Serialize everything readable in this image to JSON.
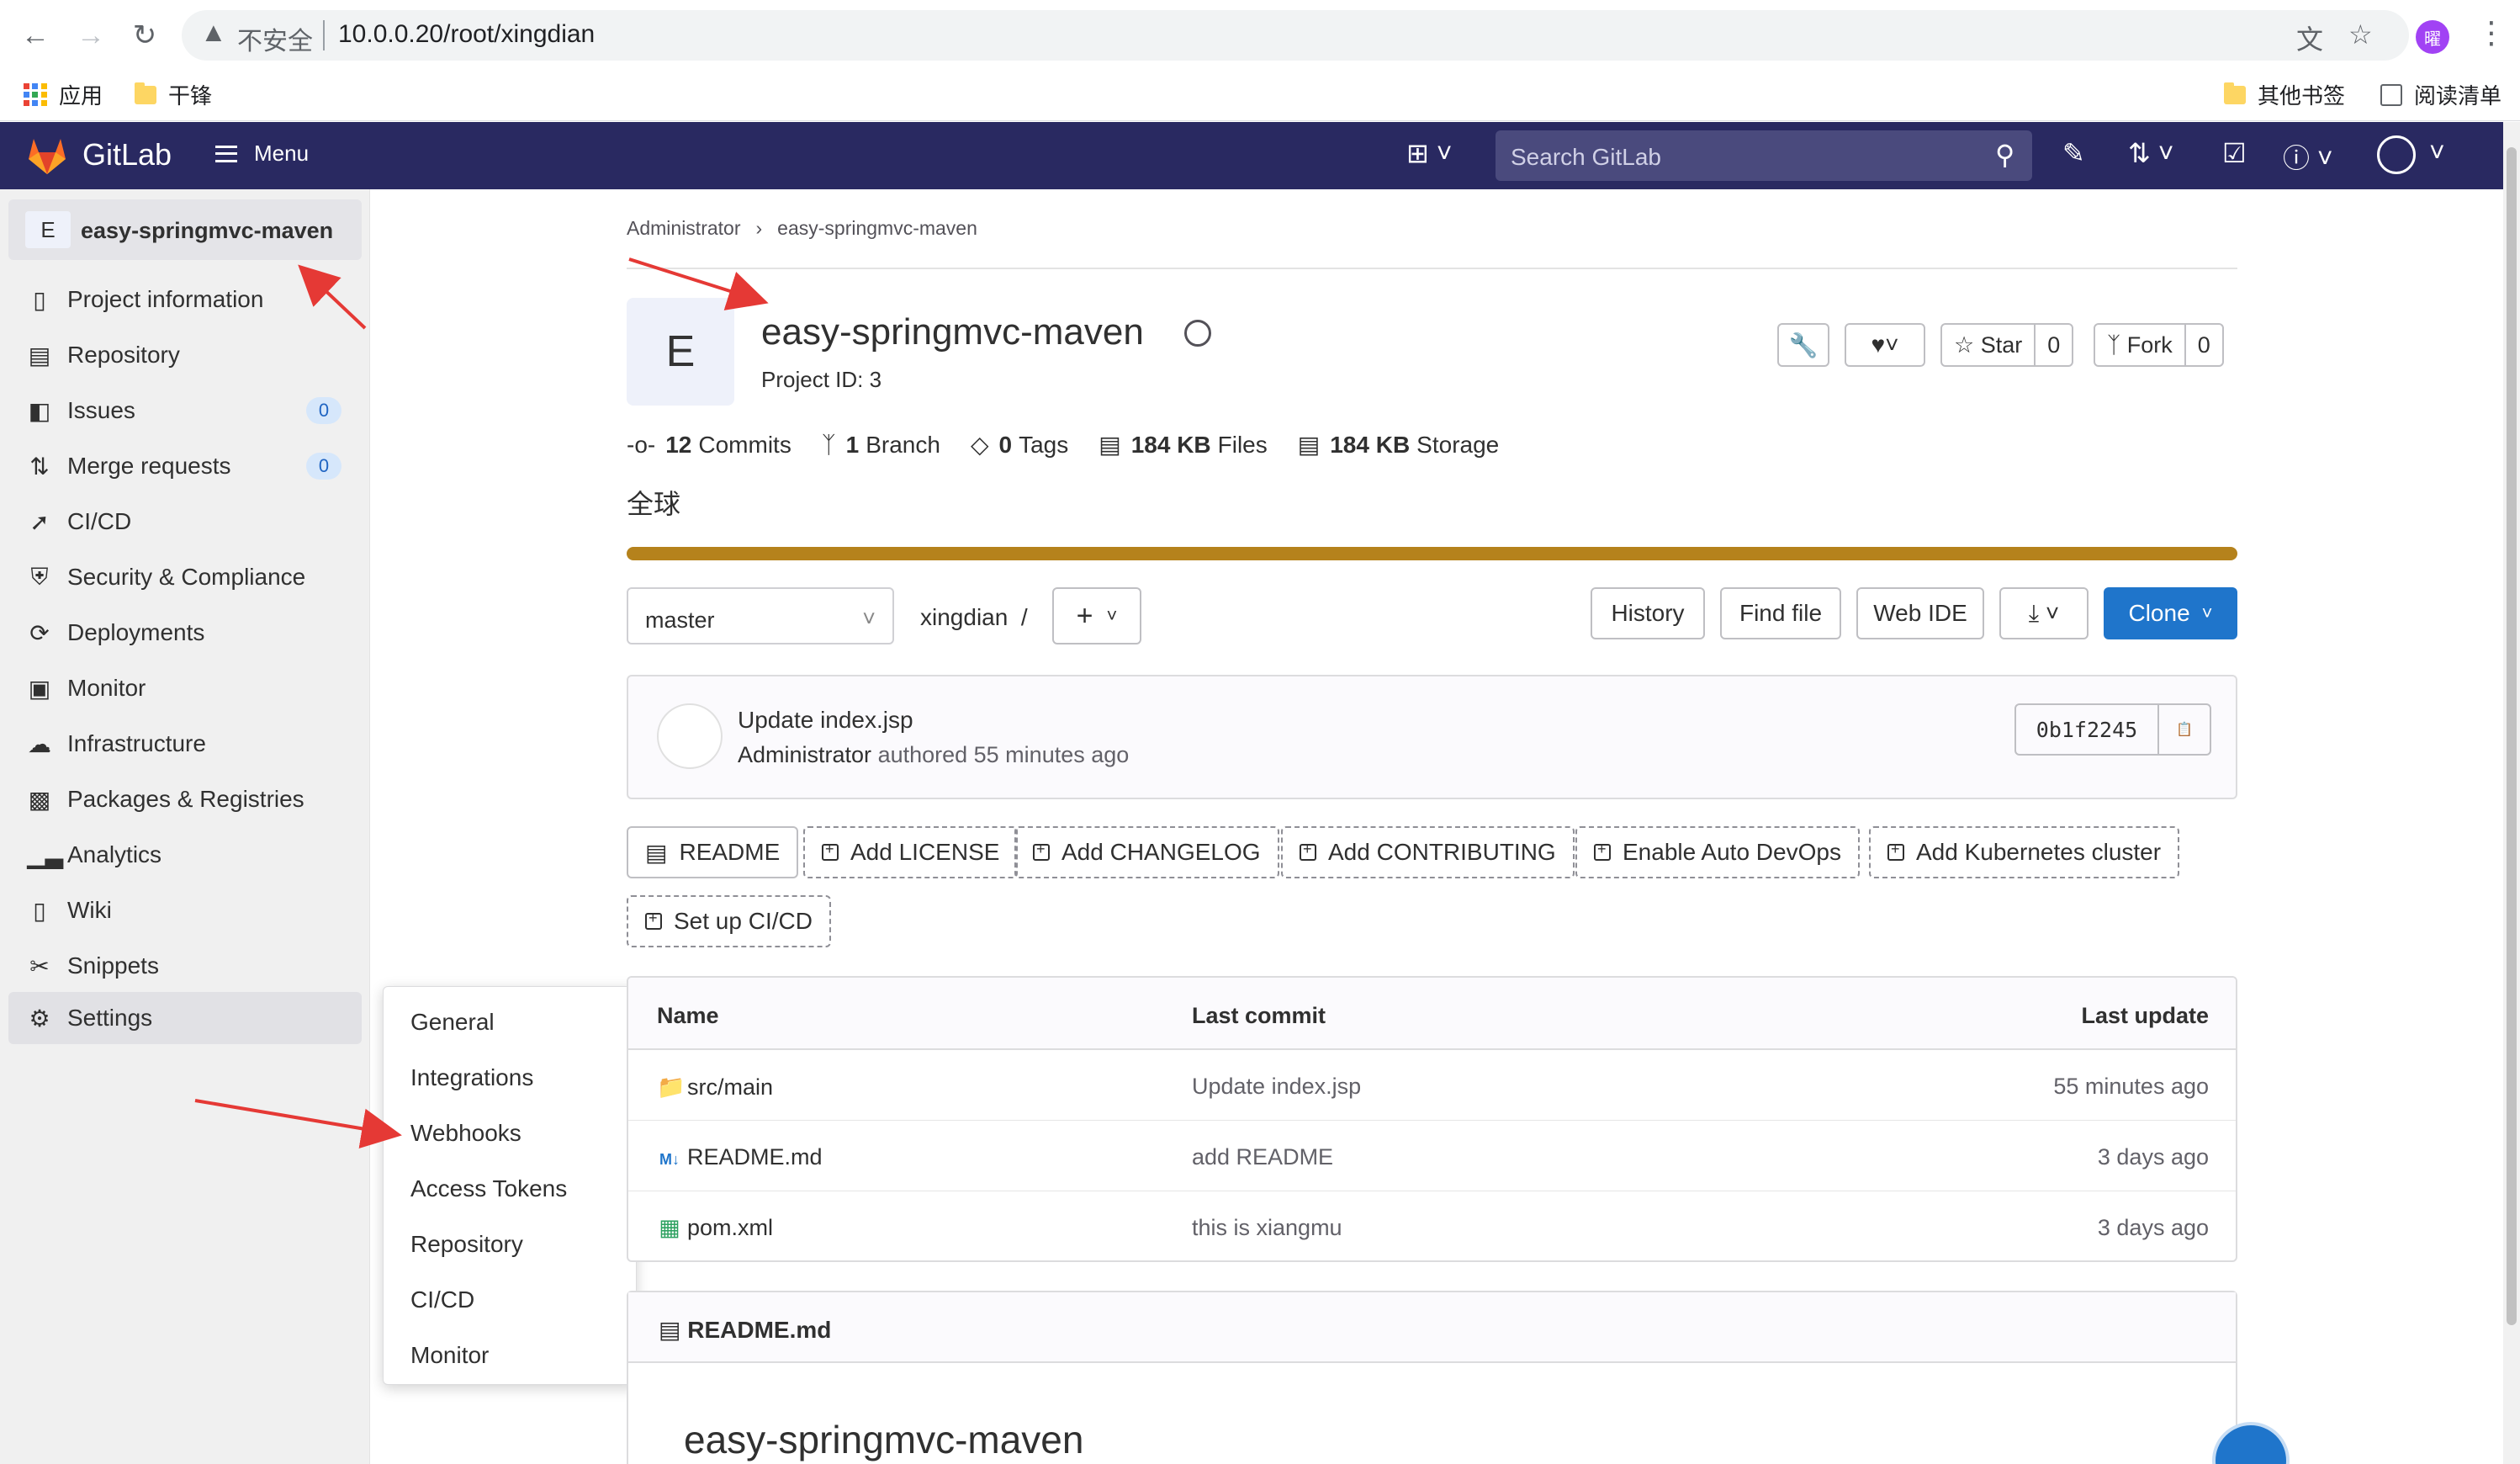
{
  "browser": {
    "insecure_label": "不安全",
    "url": "10.0.0.20/root/xingdian",
    "profile_initial": "曜",
    "bookmarks": [
      "应用",
      "干锋"
    ],
    "bookmarks_right": [
      "其他书签",
      "阅读清单"
    ]
  },
  "header": {
    "brand": "GitLab",
    "menu_label": "Menu",
    "search_placeholder": "Search GitLab"
  },
  "sidebar": {
    "project_initial": "E",
    "project_name": "easy-springmvc-maven",
    "items": [
      {
        "label": "Project information",
        "icon": "info-icon"
      },
      {
        "label": "Repository",
        "icon": "doc-icon"
      },
      {
        "label": "Issues",
        "icon": "issues-icon",
        "badge": "0"
      },
      {
        "label": "Merge requests",
        "icon": "merge-icon",
        "badge": "0"
      },
      {
        "label": "CI/CD",
        "icon": "rocket-icon"
      },
      {
        "label": "Security & Compliance",
        "icon": "shield-icon"
      },
      {
        "label": "Deployments",
        "icon": "deploy-icon"
      },
      {
        "label": "Monitor",
        "icon": "monitor-icon"
      },
      {
        "label": "Infrastructure",
        "icon": "cloud-icon"
      },
      {
        "label": "Packages & Registries",
        "icon": "package-icon"
      },
      {
        "label": "Analytics",
        "icon": "chart-icon"
      },
      {
        "label": "Wiki",
        "icon": "book-icon"
      },
      {
        "label": "Snippets",
        "icon": "scissors-icon"
      },
      {
        "label": "Settings",
        "icon": "gear-icon"
      }
    ],
    "settings_flyout": [
      "General",
      "Integrations",
      "Webhooks",
      "Access Tokens",
      "Repository",
      "CI/CD",
      "Monitor"
    ]
  },
  "breadcrumb": [
    "Administrator",
    "easy-springmvc-maven"
  ],
  "project": {
    "initial": "E",
    "name": "easy-springmvc-maven",
    "id_label": "Project ID: 3",
    "star_label": "Star",
    "star_count": "0",
    "fork_label": "Fork",
    "fork_count": "0",
    "description": "全球"
  },
  "stats": [
    {
      "value": "12",
      "label": "Commits"
    },
    {
      "value": "1",
      "label": "Branch"
    },
    {
      "value": "0",
      "label": "Tags"
    },
    {
      "value": "184 KB",
      "label": "Files"
    },
    {
      "value": "184 KB",
      "label": "Storage"
    }
  ],
  "repo_bar": {
    "branch": "master",
    "path": "xingdian",
    "history": "History",
    "find_file": "Find file",
    "web_ide": "Web IDE",
    "clone": "Clone"
  },
  "last_commit": {
    "title": "Update index.jsp",
    "author": "Administrator",
    "authored": "authored 55 minutes ago",
    "sha": "0b1f2245"
  },
  "quick_actions": [
    "README",
    "Add LICENSE",
    "Add CHANGELOG",
    "Add CONTRIBUTING",
    "Enable Auto DevOps",
    "Add Kubernetes cluster",
    "Set up CI/CD"
  ],
  "file_table": {
    "headers": {
      "name": "Name",
      "last_commit": "Last commit",
      "last_update": "Last update"
    },
    "rows": [
      {
        "name": "src/main",
        "icon": "folder-icon",
        "commit": "Update index.jsp",
        "updated": "55 minutes ago"
      },
      {
        "name": "README.md",
        "icon": "markdown-icon",
        "commit": "add README",
        "updated": "3 days ago"
      },
      {
        "name": "pom.xml",
        "icon": "xml-file-icon",
        "commit": "this is xiangmu",
        "updated": "3 days ago"
      }
    ]
  },
  "readme": {
    "file": "README.md",
    "heading": "easy-springmvc-maven"
  },
  "colors": {
    "header_bg": "#292961",
    "language_bar": "#b5821c",
    "primary_button": "#1f75cb",
    "annotation_arrow": "#e53935"
  }
}
